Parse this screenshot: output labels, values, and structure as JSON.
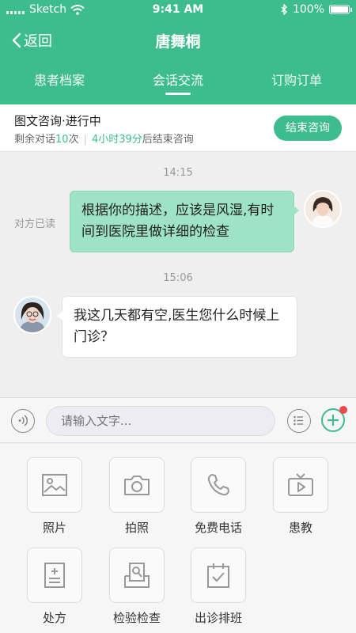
{
  "status": {
    "carrier": "Sketch",
    "time": "9:41 AM",
    "battery": "100%"
  },
  "nav": {
    "back_label": "返回",
    "title": "唐舞桐"
  },
  "tabs": [
    {
      "label": "患者档案"
    },
    {
      "label": "会话交流"
    },
    {
      "label": "订购订单"
    }
  ],
  "consult": {
    "title": "图文咨询·进行中",
    "remaining_prefix": "剩余对话",
    "remaining_count": "10",
    "remaining_suffix": "次",
    "time_left": "4小时39分",
    "time_suffix": "后结束咨询",
    "end_button": "结束咨询"
  },
  "messages": [
    {
      "time": "14:15",
      "read_status": "对方已读",
      "text": "根据你的描述，应该是风湿,有时间到医院里做详细的检查"
    },
    {
      "time": "15:06",
      "text": "我这几天都有空,医生您什么时候上门诊？"
    }
  ],
  "input": {
    "placeholder": "请输入文字..."
  },
  "tools": [
    {
      "label": "照片"
    },
    {
      "label": "拍照"
    },
    {
      "label": "免费电话"
    },
    {
      "label": "患教"
    },
    {
      "label": "处方"
    },
    {
      "label": "检验检查"
    },
    {
      "label": "出诊排班"
    }
  ],
  "colors": {
    "accent": "#3dbd8e",
    "sent_bubble": "#9fe3c6",
    "badge": "#f04848"
  }
}
